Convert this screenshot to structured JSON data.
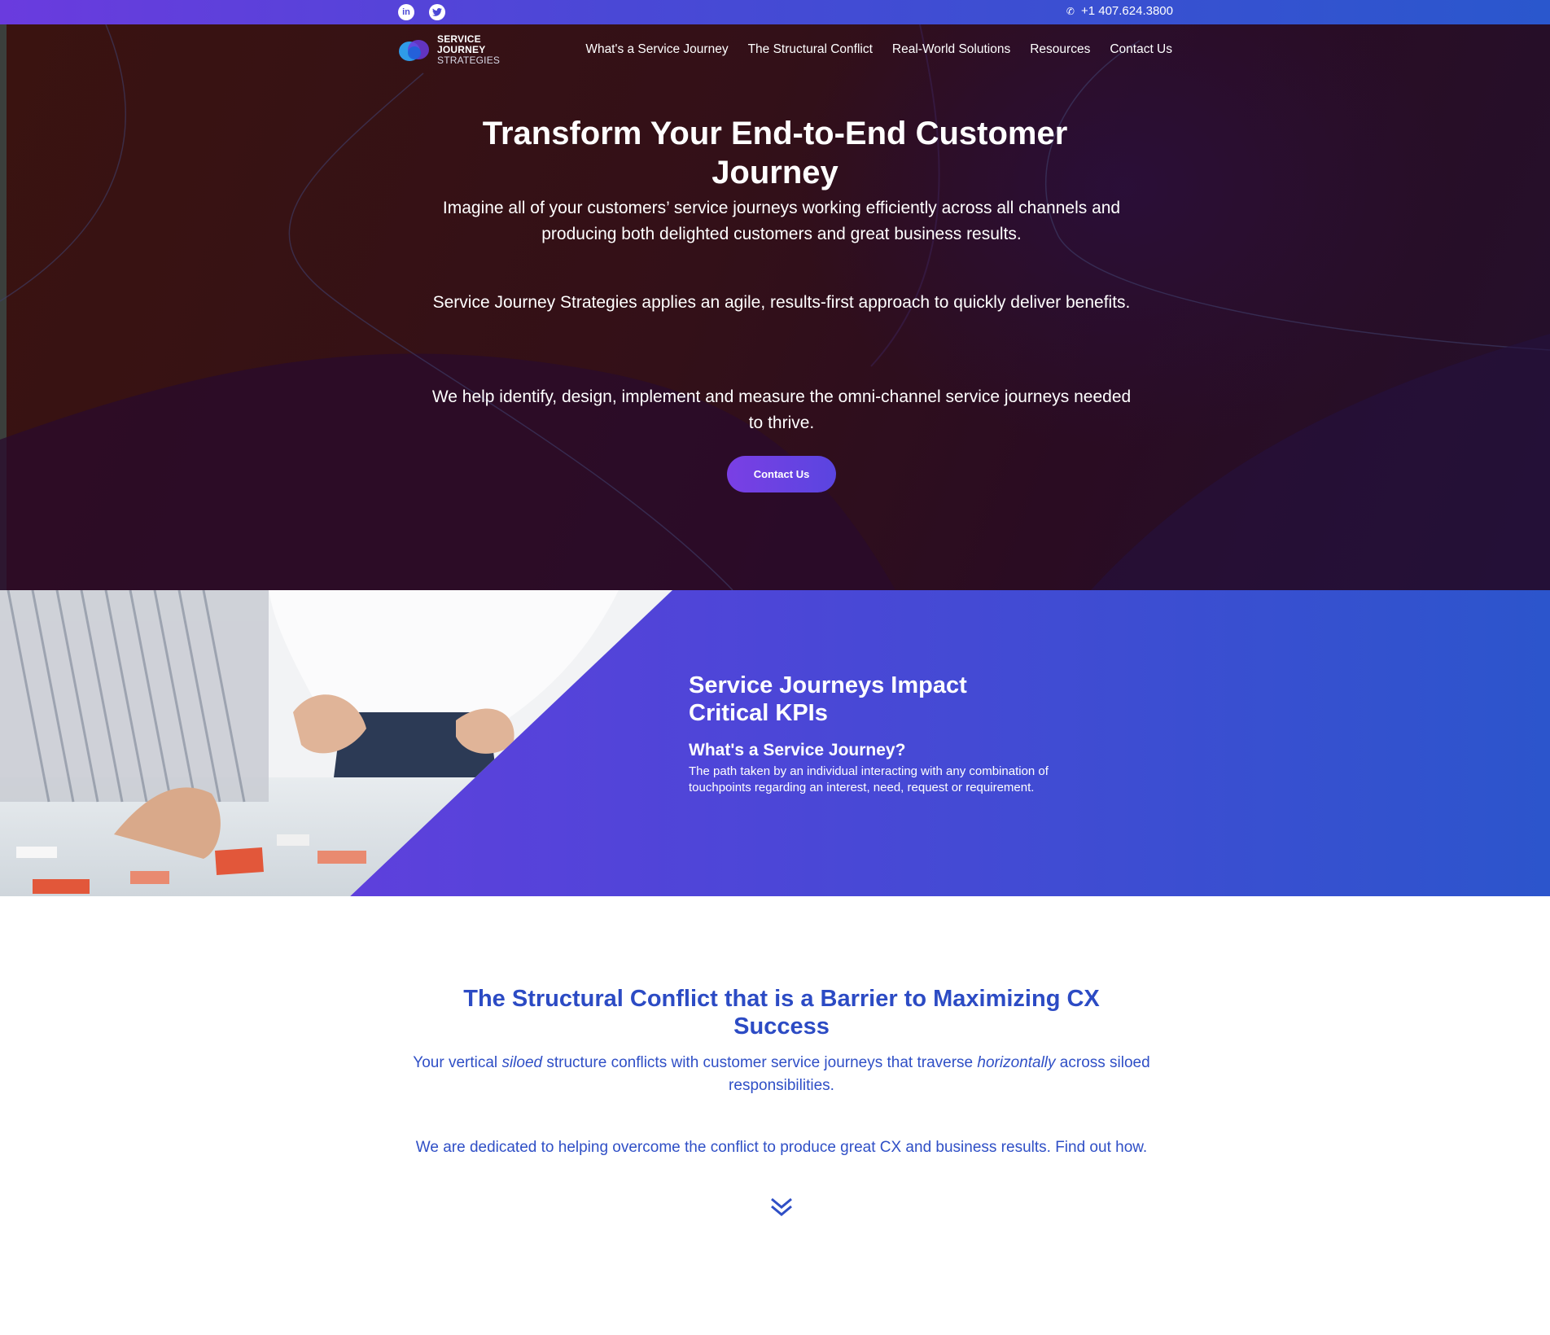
{
  "topbar": {
    "social": [
      {
        "name": "linkedin-icon",
        "glyph": "in"
      },
      {
        "name": "twitter-icon",
        "glyph": "t"
      }
    ],
    "phone": "+1 407.624.3800"
  },
  "logo": {
    "line1": "SERVICE",
    "line2": "JOURNEY",
    "line3": "STRATEGIES"
  },
  "nav": {
    "items": [
      "What's a Service Journey",
      "The Structural Conflict",
      "Real-World Solutions",
      "Resources",
      "Contact Us"
    ]
  },
  "hero": {
    "title": "Transform Your End-to-End Customer Journey",
    "p1": "Imagine all of your customers’ service journeys working efficiently across all channels and producing both delighted customers and great business results.",
    "p2": "Service Journey Strategies applies an agile, results-first approach to quickly deliver benefits.",
    "p3": "We help identify, design, implement and measure the omni-channel service journeys needed to thrive.",
    "cta": "Contact Us"
  },
  "kpi": {
    "title": "Service Journeys Impact Critical KPIs",
    "subtitle": "What's a Service Journey?",
    "description": "The path taken by an individual interacting with any combination of touchpoints regarding an interest, need, request or requirement."
  },
  "conflict": {
    "title": "The Structural Conflict that is a Barrier to Maximizing CX Success",
    "p1_a": "Your vertical ",
    "p1_em1": "siloed",
    "p1_b": " structure conflicts with customer service journeys that traverse ",
    "p1_em2": "horizontally",
    "p1_c": " across siloed responsibilities.",
    "p2": "We are dedicated to helping overcome the conflict to produce great CX and business results. Find out how."
  },
  "colors": {
    "topbar_start": "#6a3bde",
    "topbar_end": "#2a57cd",
    "hero_bg": "#331018",
    "accent_blue": "#2c4bc4"
  }
}
